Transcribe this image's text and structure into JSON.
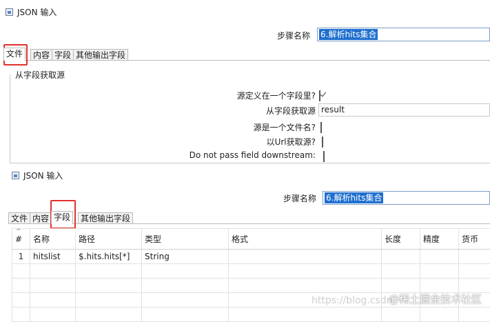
{
  "top": {
    "window_title": "JSON 输入",
    "step_label": "步骤名称",
    "step_value": "6.解析hits集合",
    "tabs": [
      "文件",
      "内容",
      "字段",
      "其他输出字段"
    ],
    "group_title": "从字段获取源",
    "form": {
      "source_in_field_label": "源定义在一个字段里?",
      "source_in_field_checked": true,
      "get_source_from_field_label": "从字段获取源",
      "get_source_from_field_value": "result",
      "source_is_filename_label": "源是一个文件名?",
      "source_is_filename_checked": false,
      "get_from_url_label": "以Url获取源?",
      "get_from_url_checked": false,
      "do_not_pass_label": "Do not pass field downstream:",
      "do_not_pass_checked": false
    }
  },
  "bottom": {
    "window_title": "JSON 输入",
    "step_label": "步骤名称",
    "step_value": "6.解析hits集合",
    "tabs": [
      "文件",
      "内容",
      "字段",
      "其他输出字段"
    ],
    "table": {
      "headers": [
        "#",
        "名称",
        "路径",
        "类型",
        "格式",
        "长度",
        "精度",
        "货币"
      ],
      "rows": [
        [
          "1",
          "hitslist",
          "$.hits.hits[*]",
          "String",
          "",
          "",
          "",
          ""
        ]
      ]
    }
  },
  "watermark": {
    "url": "https://blog.csdn",
    "brand": "@稀土掘金技术社区"
  },
  "colors": {
    "highlight_box": "#e0312a",
    "selection": "#1f6fcf"
  }
}
